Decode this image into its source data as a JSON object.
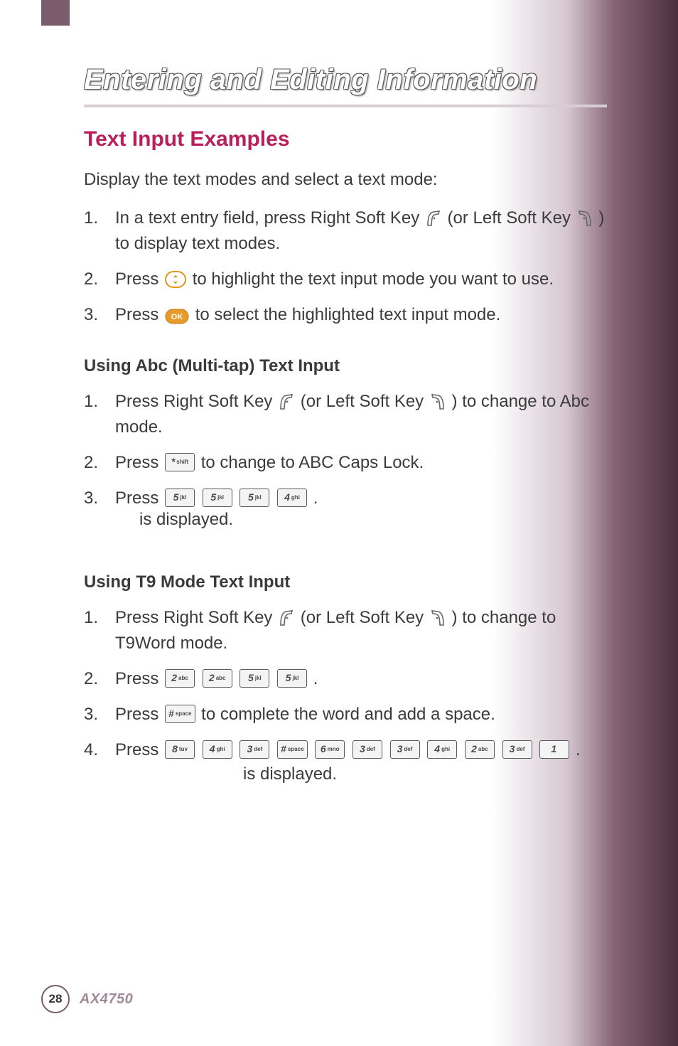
{
  "page": {
    "title": "Entering and Editing Information",
    "section_title": "Text Input Examples",
    "intro": "Display the text modes and select a text mode:",
    "steps_main": [
      {
        "num": "1.",
        "pre": "In a text entry field, press Right Soft Key ",
        "mid": " (or Left Soft Key ",
        "post": ")  to display text modes."
      },
      {
        "num": "2.",
        "pre": "Press ",
        "post": " to highlight the text input mode you want to use."
      },
      {
        "num": "3.",
        "pre": "Press ",
        "post": " to select the highlighted text input mode."
      }
    ],
    "sub1_title": "Using Abc (Multi-tap) Text Input",
    "sub1_steps": [
      {
        "num": "1.",
        "pre": "Press Right Soft Key ",
        "mid": " (or Left Soft Key ",
        "post": ")  to change to Abc mode."
      },
      {
        "num": "2.",
        "pre": "Press ",
        "post": " to change to ABC Caps Lock."
      },
      {
        "num": "3.",
        "pre": "Press ",
        "post": "."
      }
    ],
    "sub1_result": "is displayed.",
    "sub2_title": "Using T9 Mode Text Input",
    "sub2_steps": [
      {
        "num": "1.",
        "pre": "Press Right Soft Key ",
        "mid": " (or Left Soft Key ",
        "post": ")  to change to T9Word mode."
      },
      {
        "num": "2.",
        "pre": "Press ",
        "post": " ."
      },
      {
        "num": "3.",
        "pre": "Press ",
        "post": " to complete the word and add a space."
      },
      {
        "num": "4.",
        "pre": "Press ",
        "post": "."
      }
    ],
    "sub2_result": "is displayed.",
    "keys": {
      "star": {
        "d": "*",
        "s": "shift"
      },
      "hash": {
        "d": "#",
        "s": "space"
      },
      "k1": {
        "d": "1",
        "s": ""
      },
      "k2": {
        "d": "2",
        "s": "abc"
      },
      "k3": {
        "d": "3",
        "s": "def"
      },
      "k4": {
        "d": "4",
        "s": "ghi"
      },
      "k5": {
        "d": "5",
        "s": "jkl"
      },
      "k6": {
        "d": "6",
        "s": "mno"
      },
      "k8": {
        "d": "8",
        "s": "tuv"
      }
    },
    "footer": {
      "page": "28",
      "model": "AX4750"
    }
  }
}
